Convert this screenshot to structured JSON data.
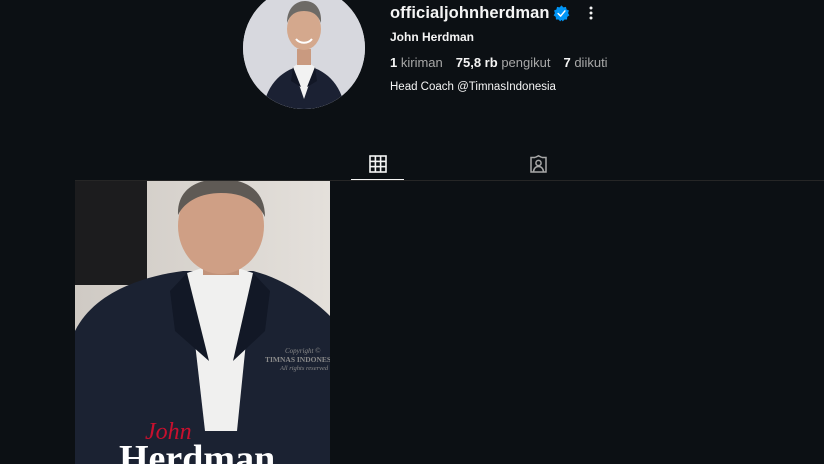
{
  "profile": {
    "username": "officialjohnherdman",
    "full_name": "John Herdman",
    "bio": "Head Coach @TimnasIndonesia",
    "verified": true,
    "verified_color": "#0095f6"
  },
  "stats": {
    "posts_count": "1",
    "posts_label": "kiriman",
    "followers_count": "75,8 rb",
    "followers_label": "pengikut",
    "following_count": "7",
    "following_label": "diikuti"
  },
  "tabs": [
    {
      "name": "posts",
      "icon": "grid-icon",
      "active": true
    },
    {
      "name": "tagged",
      "icon": "tagged-user-icon",
      "active": false
    }
  ],
  "post": {
    "overlay_first": "John",
    "overlay_last": "Herdman",
    "watermark": [
      "Copyright ©",
      "TIMNAS INDONESIA",
      "All rights reserved"
    ]
  },
  "colors": {
    "background": "#0c1014",
    "text": "#f5f5f5",
    "muted": "#a8a8a8",
    "divider": "#262626",
    "accent_red": "#c8102e"
  }
}
